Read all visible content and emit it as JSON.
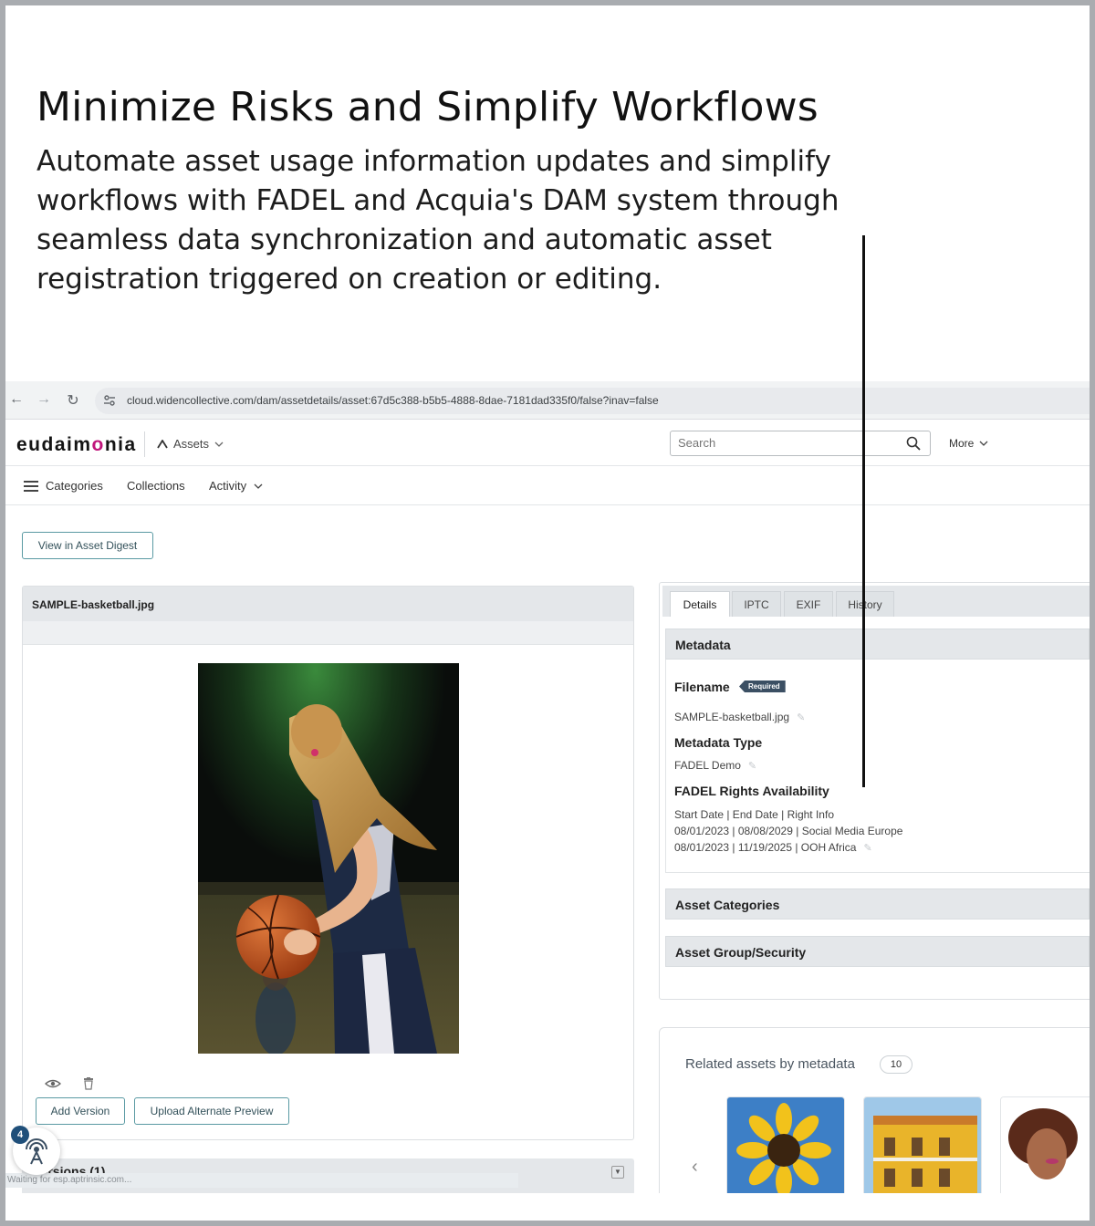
{
  "hero": {
    "title": "Minimize Risks and Simplify Workflows",
    "body": "Automate asset usage information updates and simplify workflows with FADEL and Acquia's DAM system through seamless data synchronization and automatic asset registration triggered on creation or editing."
  },
  "browser": {
    "url": "cloud.widencollective.com/dam/assetdetails/asset:67d5c388-b5b5-4888-8dae-7181dad335f0/false?inav=false",
    "status_text": "Waiting for esp.aptrinsic.com..."
  },
  "header": {
    "logo_pre": "eudaim",
    "logo_dot": "o",
    "logo_post": "nia",
    "assets_label": "Assets",
    "search_placeholder": "Search",
    "more_label": "More"
  },
  "subnav": {
    "categories": "Categories",
    "collections": "Collections",
    "activity": "Activity"
  },
  "asset": {
    "view_digest_label": "View in Asset Digest",
    "filename_title": "SAMPLE-basketball.jpg",
    "add_version_label": "Add Version",
    "upload_preview_label": "Upload Alternate Preview",
    "versions_label": "Versions (1)"
  },
  "help": {
    "badge_count": "4"
  },
  "details": {
    "tabs": [
      "Details",
      "IPTC",
      "EXIF",
      "History"
    ],
    "metadata_heading": "Metadata",
    "filename_label": "Filename",
    "required_badge": "Required",
    "filename_value": "SAMPLE-basketball.jpg",
    "metadata_type_label": "Metadata Type",
    "metadata_type_value": "FADEL Demo",
    "rights_label": "FADEL Rights Availability",
    "rights_header": "Start Date | End Date | Right Info",
    "rights_rows": [
      "08/01/2023 | 08/08/2029 | Social Media Europe",
      "08/01/2023 | 11/19/2025 | OOH Africa"
    ],
    "asset_categories_heading": "Asset Categories",
    "asset_group_heading": "Asset Group/Security"
  },
  "related": {
    "title": "Related assets by metadata",
    "count": "10"
  },
  "colors": {
    "accent_teal": "#5a9aa3",
    "logo_dot": "#c0157b",
    "panel_header": "#e4e7ea",
    "badge_navy": "#3b4f63"
  }
}
